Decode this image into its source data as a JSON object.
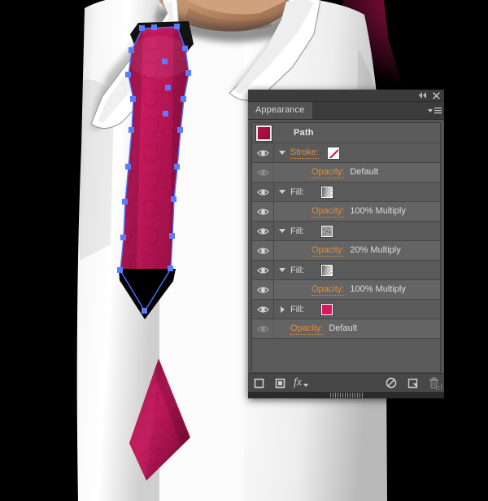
{
  "artwork": {
    "description": "Vector illustration of a man's white shirt collar with a crimson necktie, path selected showing blue anchor points",
    "colors": {
      "background": "#000000",
      "tie_crimson": "#c2185b",
      "tie_dark": "#8e0f3c",
      "shirt_white": "#f4f4f4",
      "skin": "#c99a76",
      "path_blue": "#4f6fff",
      "anchor_blue": "#5b7cff",
      "glow_crimson": "#8e0f3c"
    }
  },
  "panel": {
    "titlebar": {
      "collapse_icon": "double-left-arrow-icon",
      "close_icon": "close-icon"
    },
    "tab_label": "Appearance",
    "menu_icon": "panel-menu-icon",
    "header": {
      "label": "Path",
      "swatch_color": "#a81042"
    },
    "rows": [
      {
        "id": "stroke",
        "visible": true,
        "disclosure": "down",
        "label": "Stroke:",
        "label_type": "link",
        "swatch": "stroke-none-swatch",
        "swatch_color": "#ffffff",
        "indent": "normal"
      },
      {
        "id": "stroke-opacity",
        "visible": false,
        "disclosure": "none",
        "label": "Opacity:",
        "label_type": "link",
        "value": "Default",
        "indent": "deep"
      },
      {
        "id": "fill-1",
        "visible": true,
        "disclosure": "down",
        "label": "Fill:",
        "label_type": "plain",
        "swatch": "checker-gradient-swatch",
        "indent": "normal"
      },
      {
        "id": "fill-1-opacity",
        "visible": true,
        "disclosure": "none",
        "label": "Opacity:",
        "label_type": "link",
        "value": "100% Multiply",
        "indent": "deep"
      },
      {
        "id": "fill-2",
        "visible": true,
        "disclosure": "down",
        "label": "Fill:",
        "label_type": "plain",
        "swatch": "noise-texture-swatch",
        "indent": "normal"
      },
      {
        "id": "fill-2-opacity",
        "visible": true,
        "disclosure": "none",
        "label": "Opacity:",
        "label_type": "link",
        "value": "20% Multiply",
        "indent": "deep"
      },
      {
        "id": "fill-3",
        "visible": true,
        "disclosure": "down",
        "label": "Fill:",
        "label_type": "plain",
        "swatch": "checker-gradient-swatch",
        "indent": "normal"
      },
      {
        "id": "fill-3-opacity",
        "visible": true,
        "disclosure": "none",
        "label": "Opacity:",
        "label_type": "link",
        "value": "100% Multiply",
        "indent": "deep"
      },
      {
        "id": "fill-4",
        "visible": true,
        "disclosure": "right",
        "label": "Fill:",
        "label_type": "plain",
        "swatch": "solid-color-swatch",
        "swatch_color": "#d81b60",
        "indent": "normal"
      },
      {
        "id": "fill-4-opacity",
        "visible": false,
        "disclosure": "none",
        "label": "Opacity:",
        "label_type": "link",
        "value": "Default",
        "indent": "shallow"
      }
    ],
    "footer": {
      "buttons": [
        {
          "id": "add-new-stroke",
          "icon": "new-stroke-icon"
        },
        {
          "id": "add-new-fill",
          "icon": "new-fill-icon"
        },
        {
          "id": "add-new-effect",
          "icon": "fx-icon"
        },
        {
          "id": "clear-appearance",
          "icon": "clear-appearance-icon"
        },
        {
          "id": "duplicate-item",
          "icon": "duplicate-icon"
        },
        {
          "id": "delete-item",
          "icon": "trash-icon"
        }
      ],
      "fx_label": "fx",
      "resize_grip_icon": "resize-grip-icon"
    }
  }
}
